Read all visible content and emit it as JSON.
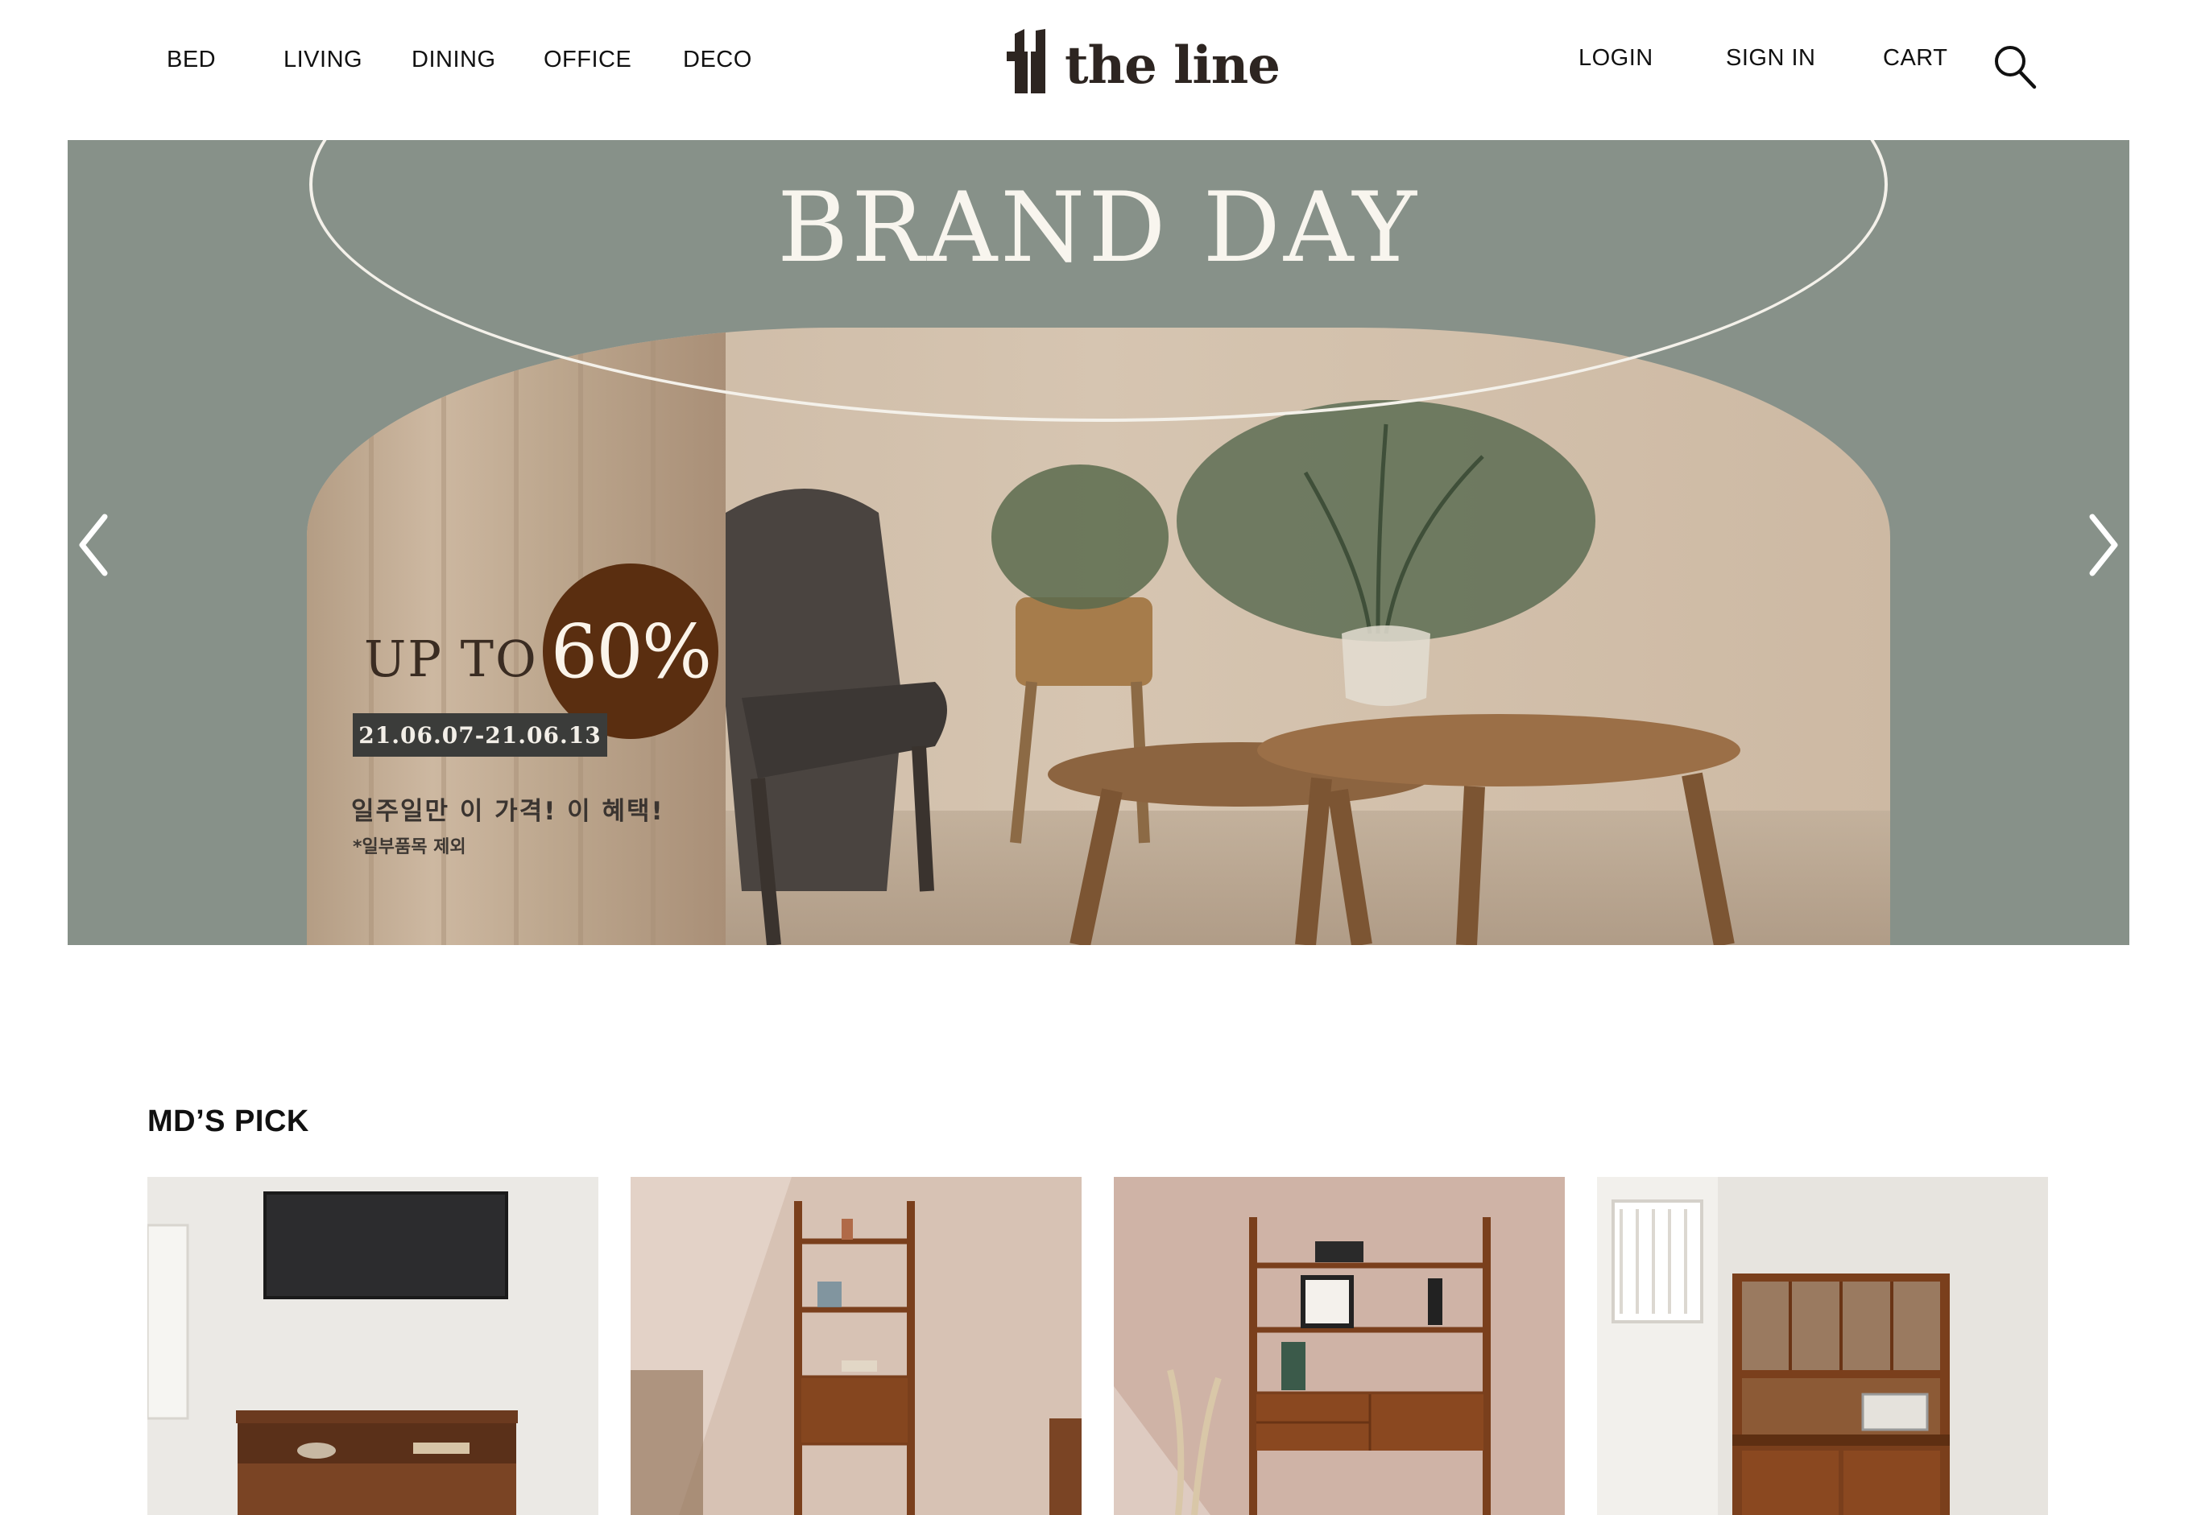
{
  "nav": {
    "categories": [
      "BED",
      "LIVING",
      "DINING",
      "OFFICE",
      "DECO"
    ],
    "account": [
      "LOGIN",
      "SIGN IN",
      "CART"
    ]
  },
  "brand": {
    "name": "the line",
    "mark_icon": "tl-monogram-icon",
    "color": "#2d2521"
  },
  "search": {
    "icon": "search-icon"
  },
  "banner": {
    "title": "BRAND DAY",
    "up_to": "UP TO",
    "discount": "60%",
    "dates": "21.06.07-21.06.13",
    "promo": "일주일만 이 가격! 이 혜택!",
    "note": "*일부품목 제외",
    "background_color": "#879189",
    "badge_color": "#5a2e10",
    "prev_icon": "chevron-left-icon",
    "next_icon": "chevron-right-icon"
  },
  "section": {
    "title": "MD’S PICK"
  },
  "products": [
    {
      "image": "tv-console-cabinet-image"
    },
    {
      "image": "narrow-bookshelf-image"
    },
    {
      "image": "wide-shelf-unit-image"
    },
    {
      "image": "kitchen-hutch-cabinet-image"
    }
  ]
}
